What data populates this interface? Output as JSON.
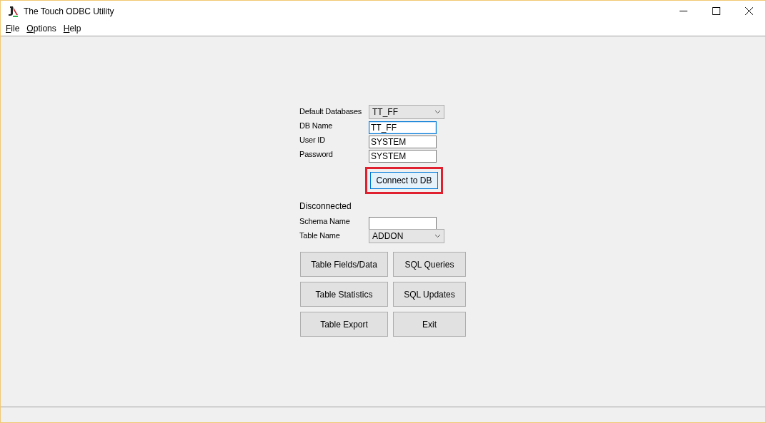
{
  "window": {
    "title": "The Touch ODBC Utility"
  },
  "menu": [
    "File",
    "Options",
    "Help"
  ],
  "connection_fields": [
    {
      "label": "Default Databases",
      "kind": "select",
      "value": "TT_FF",
      "focused": false
    },
    {
      "label": "DB Name",
      "kind": "text",
      "value": "TT_FF",
      "focused": true
    },
    {
      "label": "User ID",
      "kind": "text",
      "value": "SYSTEM",
      "focused": false
    },
    {
      "label": "Password",
      "kind": "text",
      "value": "SYSTEM",
      "focused": false
    }
  ],
  "connect_button": {
    "label": "Connect to DB",
    "highlighted": true
  },
  "status": "Disconnected",
  "table_fields": [
    {
      "label": "Schema Name",
      "kind": "text",
      "focused": false
    },
    {
      "label": "Table Name",
      "kind": "select",
      "value": "ADDON",
      "focused": false
    }
  ],
  "buttons": [
    "Table Fields/Data",
    "SQL Queries",
    "Table Statistics",
    "SQL Updates",
    "Table Export",
    "Exit"
  ]
}
